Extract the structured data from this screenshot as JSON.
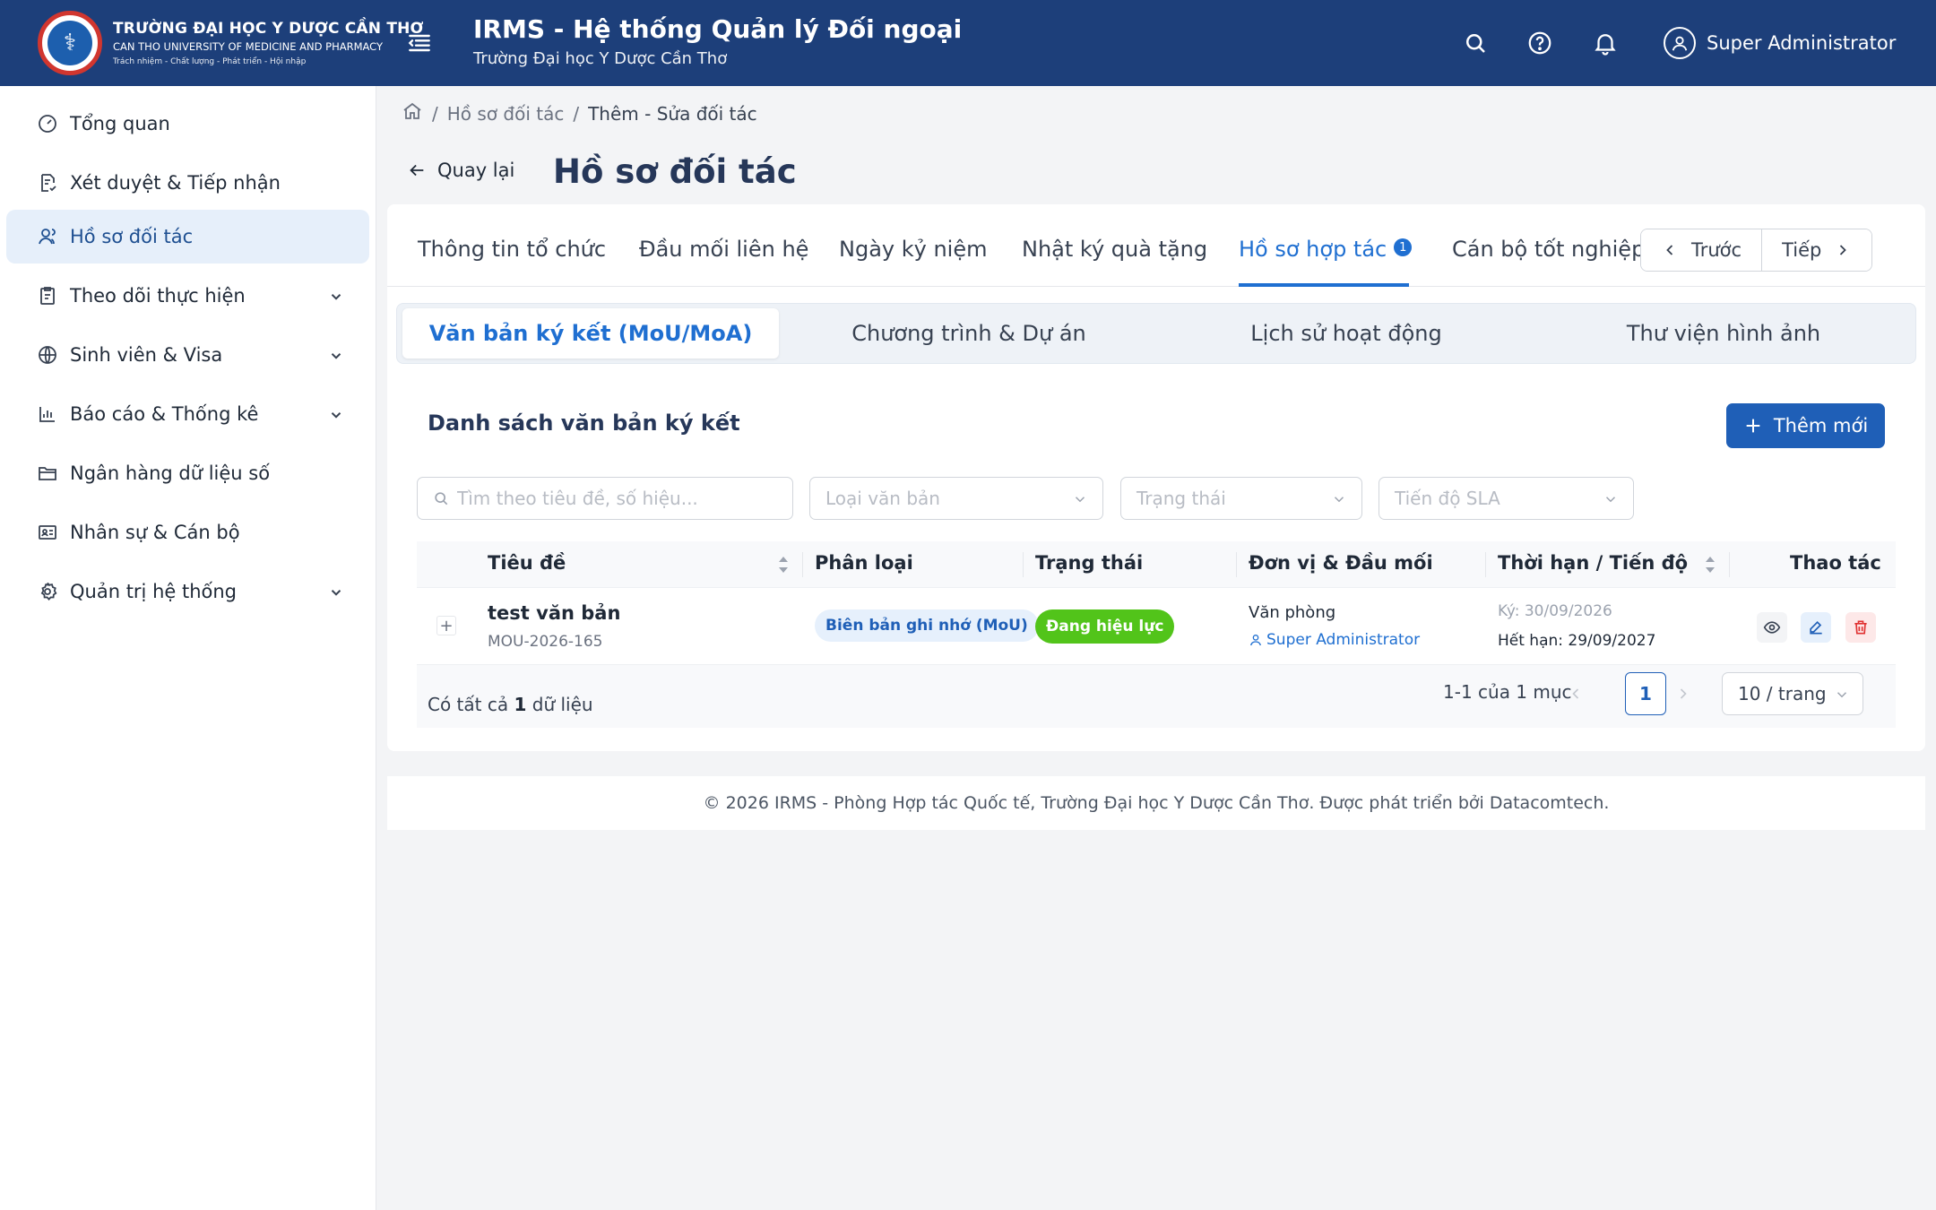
{
  "header": {
    "logo_line1": "TRƯỜNG ĐẠI HỌC Y DƯỢC CẦN THƠ",
    "logo_line2": "CAN THO UNIVERSITY OF MEDICINE AND PHARMACY",
    "logo_line3": "Trách nhiệm - Chất lượng - Phát triển - Hội nhập",
    "app_title": "IRMS - Hệ thống Quản lý Đối ngoại",
    "app_subtitle": "Trường Đại học Y Dược Cần Thơ",
    "user_name": "Super Administrator"
  },
  "sidebar": {
    "items": [
      {
        "label": "Tổng quan",
        "icon": "dashboard-icon"
      },
      {
        "label": "Xét duyệt & Tiếp nhận",
        "icon": "document-check-icon"
      },
      {
        "label": "Hồ sơ đối tác",
        "icon": "users-icon",
        "active": true
      },
      {
        "label": "Theo dõi thực hiện",
        "icon": "clipboard-icon",
        "expandable": true
      },
      {
        "label": "Sinh viên & Visa",
        "icon": "globe-icon",
        "expandable": true
      },
      {
        "label": "Báo cáo & Thống kê",
        "icon": "bar-chart-icon",
        "expandable": true
      },
      {
        "label": "Ngân hàng dữ liệu số",
        "icon": "folder-icon"
      },
      {
        "label": "Nhân sự & Cán bộ",
        "icon": "id-card-icon"
      },
      {
        "label": "Quản trị hệ thống",
        "icon": "gear-icon",
        "expandable": true
      }
    ]
  },
  "breadcrumb": {
    "sep": "/",
    "items": [
      "Hồ sơ đối tác",
      "Thêm - Sửa đối tác"
    ]
  },
  "page": {
    "back_label": "Quay lại",
    "title": "Hồ sơ đối tác"
  },
  "tabs": {
    "items": [
      "Thông tin tổ chức",
      "Đầu mối liên hệ",
      "Ngày kỷ niệm",
      "Nhật ký quà tặng",
      "Hồ sơ hợp tác",
      "Cán bộ tốt nghiệp"
    ],
    "active_badge": "1",
    "prev_label": "Trước",
    "next_label": "Tiếp"
  },
  "subtabs": [
    "Văn bản ký kết (MoU/MoA)",
    "Chương trình & Dự án",
    "Lịch sử hoạt động",
    "Thư viện hình ảnh"
  ],
  "list": {
    "title": "Danh sách văn bản ký kết",
    "add_label": "Thêm mới",
    "search_placeholder": "Tìm theo tiêu đề, số hiệu...",
    "filter_type": "Loại văn bản",
    "filter_status": "Trạng thái",
    "filter_sla": "Tiến độ SLA"
  },
  "table": {
    "columns": [
      "Tiêu đề",
      "Phân loại",
      "Trạng thái",
      "Đơn vị & Đầu mối",
      "Thời hạn / Tiến độ",
      "Thao tác"
    ],
    "rows": [
      {
        "title": "test văn bản",
        "code": "MOU-2026-165",
        "type": "Biên bản ghi nhớ (MoU)",
        "status": "Đang hiệu lực",
        "unit": "Văn phòng",
        "contact": "Super Administrator",
        "signed": "Ký: 30/09/2026",
        "expires": "Hết hạn: 29/09/2027"
      }
    ],
    "total_prefix": "Có tất cả",
    "total_count": "1",
    "total_suffix": "dữ liệu",
    "range": "1-1 của 1 mục",
    "current_page": "1",
    "per_page": "10 / trang"
  },
  "footer": {
    "text": "© 2026 IRMS - Phòng Hợp tác Quốc tế, Trường Đại học Y Dược Cần Thơ. Được phát triển bởi Datacomtech."
  },
  "colors": {
    "header_bg": "#1d3f7a",
    "primary": "#1f5fb7",
    "active_tab": "#1f6fd1",
    "status_green": "#52c41a",
    "danger": "#e03131"
  }
}
